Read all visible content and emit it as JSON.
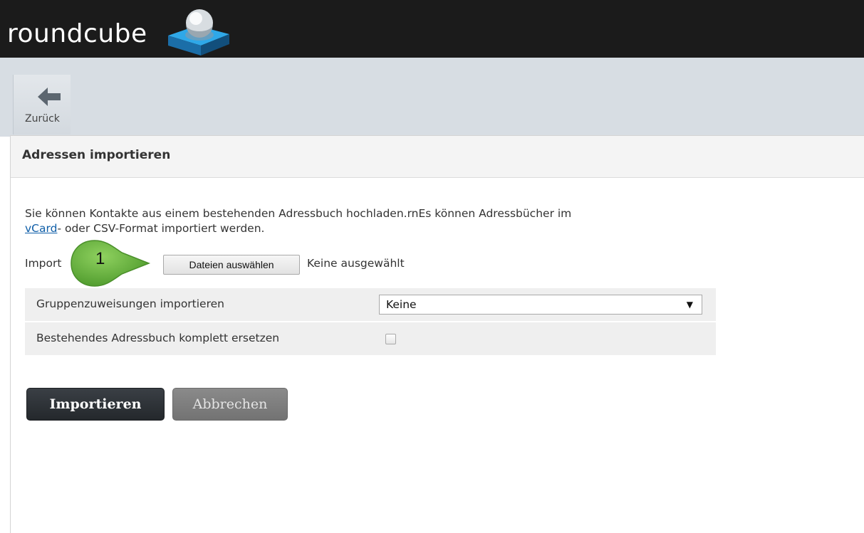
{
  "header": {
    "logo_text": "roundcube"
  },
  "toolbar": {
    "back_label": "Zurück"
  },
  "panel": {
    "title": "Adressen importieren",
    "intro_text": "Sie können Kontakte aus einem bestehenden Adressbuch hochladen.rnEs können Adressbücher im",
    "intro_link": "vCard",
    "intro_rest": "- oder CSV-Format importiert werden.",
    "import_label": "Import",
    "file_button_label": "Dateien auswählen",
    "file_status": "Keine ausgewählt",
    "callout_number": "1",
    "settings": [
      {
        "label": "Gruppenzuweisungen importieren",
        "type": "select",
        "value": "Keine"
      },
      {
        "label": "Bestehendes Adressbuch komplett ersetzen",
        "type": "checkbox",
        "checked": false
      }
    ],
    "buttons": {
      "import": "Importieren",
      "cancel": "Abbrechen"
    }
  },
  "colors": {
    "header_bg": "#1b1b1b",
    "toolbar_bg": "#d7dde3",
    "logo_blue": "#1f8fd1",
    "callout_green": "#5fa83a",
    "primary_button": "#2d3237",
    "secondary_button": "#7d7d7d"
  },
  "icons": {
    "logo": "roundcube-logo-icon",
    "back": "arrow-left-icon",
    "select": "dropdown-arrow-icon"
  }
}
